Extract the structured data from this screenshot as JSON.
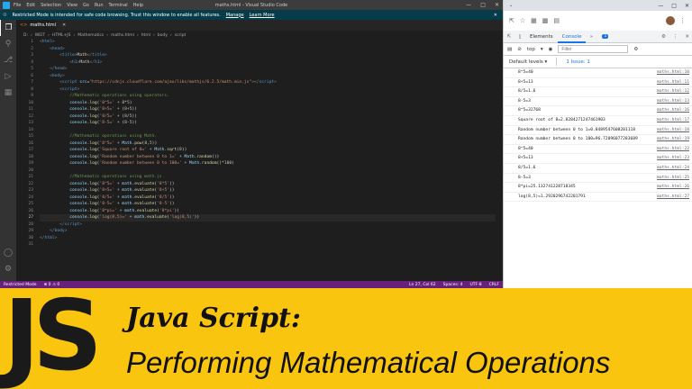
{
  "vscode": {
    "menu": [
      "File",
      "Edit",
      "Selection",
      "View",
      "Go",
      "Run",
      "Terminal",
      "Help"
    ],
    "window_title": "maths.html - Visual Studio Code",
    "restricted_banner": {
      "text": "Restricted Mode is intended for safe code browsing. Trust this window to enable all features.",
      "manage": "Manage",
      "learn_more": "Learn More"
    },
    "tab_label": "maths.html",
    "breadcrumb": [
      "D:",
      "WEIT",
      "HTML+JS",
      "Mathematics",
      "maths.html",
      "html",
      "body",
      "script"
    ],
    "line_numbers": [
      "1",
      "2",
      "3",
      "4",
      "5",
      "6",
      "7",
      "8",
      "9",
      "10",
      "11",
      "12",
      "13",
      "14",
      "15",
      "16",
      "17",
      "18",
      "19",
      "20",
      "21",
      "22",
      "23",
      "24",
      "25",
      "26",
      "27",
      "28",
      "29",
      "30",
      "31"
    ],
    "status": {
      "restricted": "Restricted Mode",
      "problems": "⊗ 0 ⚠ 0",
      "cursor": "Ln 27, Col 62",
      "spaces": "Spaces: 4",
      "encoding": "UTF-8",
      "eol": "CRLF"
    }
  },
  "chrome": {
    "devtools_tabs": [
      "Elements",
      "Console"
    ],
    "issues_badge": "1",
    "context": "top",
    "filter_placeholder": "Filter",
    "default_levels": "Default levels ▾",
    "issue_count": "1 Issue:  1",
    "console_rows": [
      {
        "msg": "8^5=40",
        "src": "maths.html:10"
      },
      {
        "msg": "8+5=13",
        "src": "maths.html:11"
      },
      {
        "msg": "8/5=1.6",
        "src": "maths.html:12"
      },
      {
        "msg": "8-5=3",
        "src": "maths.html:13"
      },
      {
        "msg": "8^5=32768",
        "src": "maths.html:16"
      },
      {
        "msg": "Square root of 8=2.8284271247461903",
        "src": "maths.html:17"
      },
      {
        "msg": "Random number between 0 to 1=0.8489547608201118",
        "src": "maths.html:18"
      },
      {
        "msg": "Random number between 0 to 100=96.72096077283689",
        "src": "maths.html:19"
      },
      {
        "msg": "8^5=40",
        "src": "maths.html:22"
      },
      {
        "msg": "8+5=13",
        "src": "maths.html:23"
      },
      {
        "msg": "8/5=1.6",
        "src": "maths.html:24"
      },
      {
        "msg": "8-5=3",
        "src": "maths.html:25"
      },
      {
        "msg": "8*pi=25.132741228718345",
        "src": "maths.html:26"
      },
      {
        "msg": "log(8,5)=1.2920296742201791",
        "src": "maths.html:27"
      }
    ]
  },
  "banner": {
    "logo": "JS",
    "title": "Java Script:",
    "subtitle": "Performing Mathematical Operations"
  }
}
